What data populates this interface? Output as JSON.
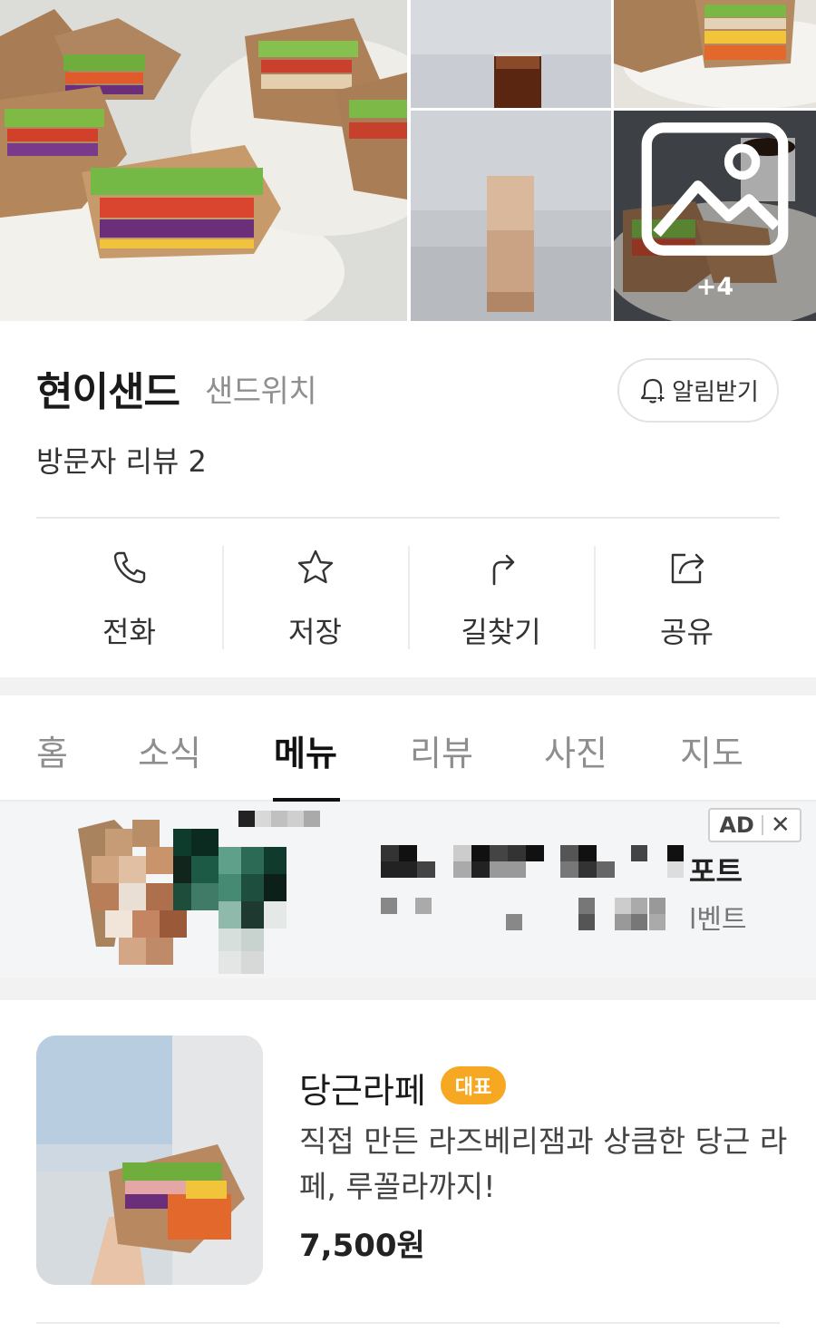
{
  "gallery": {
    "more_count": "+4",
    "photos": [
      "sandwich-plate-photo",
      "iced-americano-photo",
      "sandwich-closeup-photo",
      "iced-latte-photo",
      "coffee-and-sandwich-photo"
    ]
  },
  "place": {
    "name": "현이샌드",
    "category": "샌드위치",
    "reviews": "방문자 리뷰 2",
    "notify_label": "알림받기"
  },
  "actions": [
    {
      "label": "전화",
      "icon": "phone-icon"
    },
    {
      "label": "저장",
      "icon": "star-icon"
    },
    {
      "label": "길찾기",
      "icon": "directions-icon"
    },
    {
      "label": "공유",
      "icon": "share-icon"
    }
  ],
  "tabs": [
    "홈",
    "소식",
    "메뉴",
    "리뷰",
    "사진",
    "지도"
  ],
  "active_tab": "메뉴",
  "ad": {
    "badge": "AD",
    "line1_visible": "포트",
    "line2_visible": "l벤트"
  },
  "menu_item": {
    "name": "당근라페",
    "badge": "대표",
    "description": "직접 만든 라즈베리잼과 상큼한 당근 라페, 루꼴라까지!",
    "price": "7,500원"
  },
  "colors": {
    "badge_orange": "#f7a823",
    "text_dark": "#1a1a1a",
    "text_gray": "#8e8e8e",
    "divider": "#ececec"
  }
}
